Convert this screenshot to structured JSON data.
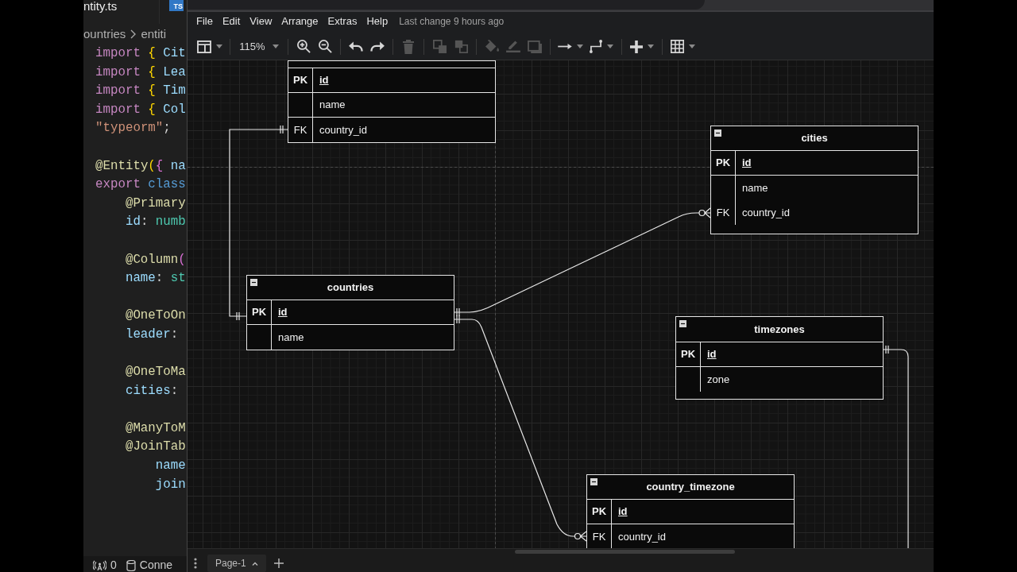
{
  "editor": {
    "tabs": [
      {
        "label": "ntity.ts"
      },
      {
        "badge": "TS"
      }
    ],
    "breadcrumb": [
      "ountries",
      "entiti"
    ],
    "code_blocks": [
      [
        [
          {
            "text": "import",
            "kind": "keyword"
          },
          {
            "text": " {",
            "kind": "bracket"
          },
          {
            "text": " Cit",
            "kind": "variable"
          }
        ],
        [
          {
            "text": "import",
            "kind": "keyword"
          },
          {
            "text": " {",
            "kind": "bracket"
          },
          {
            "text": " Lea",
            "kind": "variable"
          }
        ],
        [
          {
            "text": "import",
            "kind": "keyword"
          },
          {
            "text": " {",
            "kind": "bracket"
          },
          {
            "text": " Tim",
            "kind": "variable"
          }
        ],
        [
          {
            "text": "import",
            "kind": "keyword"
          },
          {
            "text": " {",
            "kind": "bracket"
          },
          {
            "text": " Col",
            "kind": "variable"
          }
        ],
        [
          {
            "text": "\"typeorm\"",
            "kind": "string"
          },
          {
            "text": ";",
            "kind": "plain"
          }
        ]
      ],
      [
        [
          {
            "text": "@Entity",
            "kind": "decorator"
          },
          {
            "text": "(",
            "kind": "bracket"
          },
          {
            "text": "{",
            "kind": "bracket2"
          },
          {
            "text": " na",
            "kind": "variable"
          }
        ],
        [
          {
            "text": "export",
            "kind": "keyword"
          },
          {
            "text": " class",
            "kind": "storage"
          }
        ],
        [
          {
            "text": "    @Primary",
            "kind": "decorator"
          }
        ],
        [
          {
            "text": "    id",
            "kind": "variable"
          },
          {
            "text": ": ",
            "kind": "plain"
          },
          {
            "text": "numb",
            "kind": "type"
          }
        ]
      ],
      [
        [
          {
            "text": "    @Column",
            "kind": "decorator"
          },
          {
            "text": "(",
            "kind": "bracket2"
          }
        ],
        [
          {
            "text": "    name",
            "kind": "variable"
          },
          {
            "text": ": ",
            "kind": "plain"
          },
          {
            "text": "st",
            "kind": "type"
          }
        ]
      ],
      [
        [
          {
            "text": "    @OneToOn",
            "kind": "decorator"
          }
        ],
        [
          {
            "text": "    leader",
            "kind": "variable"
          },
          {
            "text": ":",
            "kind": "plain"
          }
        ]
      ],
      [
        [
          {
            "text": "    @OneToMa",
            "kind": "decorator"
          }
        ],
        [
          {
            "text": "    cities",
            "kind": "variable"
          },
          {
            "text": ":",
            "kind": "plain"
          }
        ]
      ],
      [
        [
          {
            "text": "    @ManyToM",
            "kind": "decorator"
          }
        ],
        [
          {
            "text": "    @JoinTab",
            "kind": "decorator"
          }
        ],
        [
          {
            "text": "        name",
            "kind": "variable"
          }
        ],
        [
          {
            "text": "        join",
            "kind": "variable"
          }
        ]
      ]
    ],
    "status_bar": [
      "0",
      "Conne"
    ]
  },
  "drawio": {
    "menu": [
      "File",
      "Edit",
      "View",
      "Arrange",
      "Extras",
      "Help"
    ],
    "last_change": "Last change 9 hours ago",
    "toolbar": {
      "groups": [
        [
          {
            "kind": "icon",
            "dropdown": true,
            "disabled": false
          }
        ],
        [
          {
            "kind": "zoom",
            "label": "115%",
            "dropdown": true,
            "disabled": false
          }
        ],
        [
          {
            "kind": "icon",
            "dropdown": false,
            "disabled": false
          },
          {
            "kind": "icon",
            "dropdown": false,
            "disabled": false
          }
        ],
        [
          {
            "kind": "icon",
            "dropdown": false,
            "disabled": false
          },
          {
            "kind": "icon",
            "dropdown": false,
            "disabled": false
          }
        ],
        [
          {
            "kind": "icon",
            "dropdown": false,
            "disabled": true
          }
        ],
        [
          {
            "kind": "icon",
            "dropdown": false,
            "disabled": true
          },
          {
            "kind": "icon",
            "dropdown": false,
            "disabled": true
          }
        ],
        [
          {
            "kind": "icon",
            "dropdown": false,
            "disabled": true
          },
          {
            "kind": "icon",
            "dropdown": false,
            "disabled": true
          },
          {
            "kind": "icon",
            "dropdown": false,
            "disabled": true
          }
        ],
        [
          {
            "kind": "icon",
            "dropdown": true,
            "disabled": false
          },
          {
            "kind": "icon",
            "dropdown": true,
            "disabled": false
          }
        ],
        [
          {
            "kind": "icon",
            "dropdown": true,
            "disabled": false
          }
        ],
        [
          {
            "kind": "icon",
            "dropdown": true,
            "disabled": false
          }
        ]
      ]
    },
    "tables": [
      {
        "rows": [
          {
            "key": "PK",
            "field": "id",
            "primary": true
          },
          {
            "field": "name",
            "primary": false
          },
          {
            "key": "FK",
            "field": "country_id",
            "primary": false
          }
        ]
      },
      {
        "title": "cities",
        "rows": [
          {
            "key": "PK",
            "field": "id",
            "primary": true
          },
          {
            "field": "name",
            "primary": false
          },
          {
            "key": "FK",
            "field": "country_id",
            "primary": false
          }
        ]
      },
      {
        "title": "countries",
        "rows": [
          {
            "key": "PK",
            "field": "id",
            "primary": true
          },
          {
            "field": "name",
            "primary": false
          }
        ]
      },
      {
        "title": "timezones",
        "rows": [
          {
            "key": "PK",
            "field": "id",
            "primary": true
          },
          {
            "field": "zone",
            "primary": false
          }
        ]
      },
      {
        "title": "country_timezone",
        "rows": [
          {
            "key": "PK",
            "field": "id",
            "primary": true
          },
          {
            "key": "FK",
            "field": "country_id",
            "primary": false
          }
        ]
      }
    ],
    "pages": [
      {
        "label": "Page-1",
        "selected": true
      }
    ]
  }
}
